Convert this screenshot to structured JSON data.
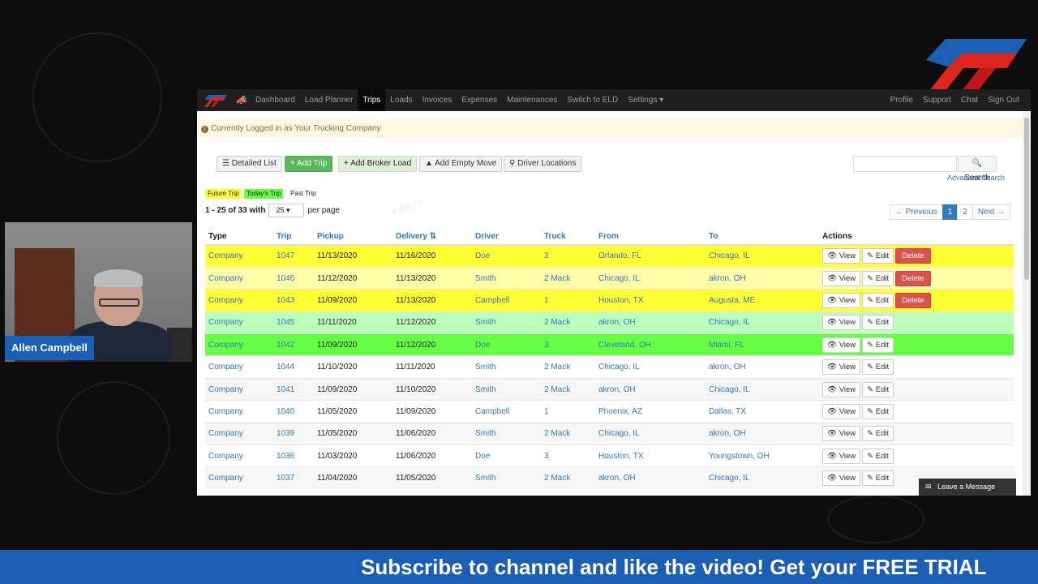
{
  "overlay": {
    "presenter_name": "Allen Campbell",
    "ticker_text": "Subscribe to channel and like the video! Get your FREE TRIAL"
  },
  "navbar": {
    "items": [
      "Dashboard",
      "Load Planner",
      "Trips",
      "Loads",
      "Invoices",
      "Expenses",
      "Maintenances",
      "Switch to ELD",
      "Settings ▾"
    ],
    "active": "Trips",
    "right_items": [
      "Profile",
      "Support",
      "Chat",
      "Sign Out"
    ]
  },
  "alert": {
    "text": "Currently Logged in as Your Trucking Company"
  },
  "toolbar": {
    "detailed_list": "Detailed List",
    "add_trip": "Add Trip",
    "add_broker_load": "Add Broker Load",
    "add_empty_move": "Add Empty Move",
    "driver_locations": "Driver Locations",
    "search_label": "Search",
    "advanced_search": "Advanced Search"
  },
  "legend": {
    "future": "Future Trip",
    "today": "Today's Trip",
    "past": "Past Trip"
  },
  "listing": {
    "range": "1 - 25 of 33 with",
    "per_page_value": "25",
    "per_page_label": "per page"
  },
  "pagination": {
    "previous": "← Previous",
    "pages": [
      "1",
      "2"
    ],
    "current": "1",
    "next": "Next →"
  },
  "table": {
    "headers": [
      "Type",
      "Trip",
      "Pickup",
      "Delivery",
      "Driver",
      "Truck",
      "From",
      "To",
      "Actions"
    ],
    "view_label": "View",
    "edit_label": "Edit",
    "delete_label": "Delete",
    "rows": [
      {
        "type": "Company",
        "trip": "1047",
        "pickup": "11/13/2020",
        "delivery": "11/16/2020",
        "driver": "Doe",
        "truck": "3",
        "from": "Orlando, FL",
        "to": "Chicago, IL",
        "status": "future-yellow",
        "deletable": true
      },
      {
        "type": "Company",
        "trip": "1046",
        "pickup": "11/12/2020",
        "delivery": "11/13/2020",
        "driver": "Smith",
        "truck": "2 Mack",
        "from": "Chicago, IL",
        "to": "akron, OH",
        "status": "future-light",
        "deletable": true
      },
      {
        "type": "Company",
        "trip": "1043",
        "pickup": "11/09/2020",
        "delivery": "11/13/2020",
        "driver": "Campbell",
        "truck": "1",
        "from": "Houston, TX",
        "to": "Augusta, ME",
        "status": "future-yellow",
        "deletable": true
      },
      {
        "type": "Company",
        "trip": "1045",
        "pickup": "11/11/2020",
        "delivery": "11/12/2020",
        "driver": "Smith",
        "truck": "2 Mack",
        "from": "akron, OH",
        "to": "Chicago, IL",
        "status": "today-light",
        "deletable": false
      },
      {
        "type": "Company",
        "trip": "1042",
        "pickup": "11/09/2020",
        "delivery": "11/12/2020",
        "driver": "Doe",
        "truck": "3",
        "from": "Cleveland, OH",
        "to": "Miami, FL",
        "status": "today-green",
        "deletable": false
      },
      {
        "type": "Company",
        "trip": "1044",
        "pickup": "11/10/2020",
        "delivery": "11/11/2020",
        "driver": "Smith",
        "truck": "2 Mack",
        "from": "Chicago, IL",
        "to": "akron, OH",
        "status": "past-white",
        "deletable": false
      },
      {
        "type": "Company",
        "trip": "1041",
        "pickup": "11/09/2020",
        "delivery": "11/10/2020",
        "driver": "Smith",
        "truck": "2 Mack",
        "from": "akron, OH",
        "to": "Chicago, IL",
        "status": "past-gray",
        "deletable": false
      },
      {
        "type": "Company",
        "trip": "1040",
        "pickup": "11/05/2020",
        "delivery": "11/09/2020",
        "driver": "Campbell",
        "truck": "1",
        "from": "Phoenix, AZ",
        "to": "Dallas, TX",
        "status": "past-white",
        "deletable": false
      },
      {
        "type": "Company",
        "trip": "1039",
        "pickup": "11/05/2020",
        "delivery": "11/06/2020",
        "driver": "Smith",
        "truck": "2 Mack",
        "from": "Chicago, IL",
        "to": "akron, OH",
        "status": "past-gray",
        "deletable": false
      },
      {
        "type": "Company",
        "trip": "1036",
        "pickup": "11/03/2020",
        "delivery": "11/06/2020",
        "driver": "Doe",
        "truck": "3",
        "from": "Houston, TX",
        "to": "Youngstown, OH",
        "status": "past-white",
        "deletable": false
      },
      {
        "type": "Company",
        "trip": "1037",
        "pickup": "11/04/2020",
        "delivery": "11/05/2020",
        "driver": "Smith",
        "truck": "2 Mack",
        "from": "akron, OH",
        "to": "Chicago, IL",
        "status": "past-gray",
        "deletable": false
      }
    ]
  },
  "chat_widget": {
    "label": "Leave a Message"
  },
  "colors": {
    "future_yellow": "#ffff33",
    "future_light": "#ffffaa",
    "today_green": "#66ff44",
    "today_light": "#bbffbb",
    "brand_blue": "#1a5fb4",
    "brand_red": "#d0201c",
    "link": "#337ab7"
  }
}
